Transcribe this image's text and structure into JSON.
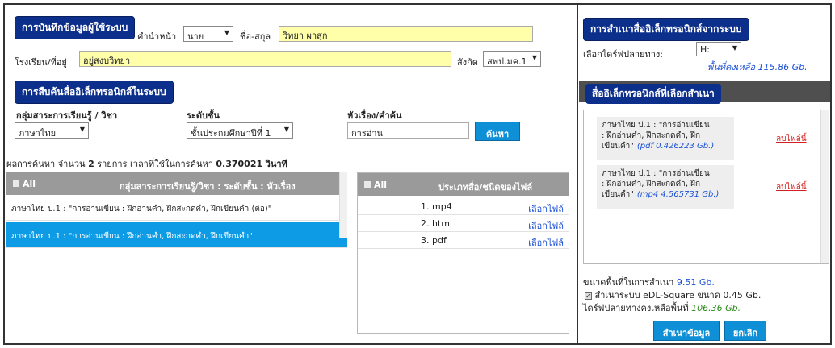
{
  "user_form": {
    "title": "การบันทึกข้อมูลผู้ใช้ระบบ",
    "prefix_label": "คำนำหน้า",
    "prefix_value": "นาย",
    "name_label": "ชื่อ-สกุล",
    "name_value": "วิทยา ผาสุก",
    "school_label": "โรงเรียน/ที่อยู่",
    "school_value": "อยู่สงบวิทยา",
    "affiliation_label": "สังกัด",
    "affiliation_value": "สพป.มค.1"
  },
  "search": {
    "title": "การสืบค้นสื่ออิเล็กทรอนิกส์ในระบบ",
    "subject_label": "กลุ่มสาระการเรียนรู้ / วิชา",
    "subject_value": "ภาษาไทย",
    "level_label": "ระดับชั้น",
    "level_value": "ชั้นประถมศึกษาปีที่ 1",
    "keyword_label": "หัวเรื่อง/คำค้น",
    "keyword_value": "การอ่าน",
    "search_button": "ค้นหา",
    "result_prefix": "ผลการค้นหา จำนวน",
    "result_count": "2",
    "result_mid": "รายการ เวลาที่ใช้ในการค้นหา",
    "result_time": "0.370021",
    "result_unit": "วินาที"
  },
  "results_table": {
    "all_label": "All",
    "header": "กลุ่มสาระการเรียนรู้/วิชา : ระดับชั้น : หัวเรื่อง",
    "rows": [
      {
        "text": "ภาษาไทย ป.1 : \"การอ่านเขียน : ฝึกอ่านคำ, ฝึกสะกดคำ, ฝึกเขียนคำ (ต่อ)\"",
        "selected": false
      },
      {
        "text": "ภาษาไทย ป.1 : \"การอ่านเขียน : ฝึกอ่านคำ, ฝึกสะกดคำ, ฝึกเขียนคำ\"",
        "selected": true
      }
    ]
  },
  "files_table": {
    "all_label": "All",
    "header": "ประเภทสื่อ/ชนิดของไฟล์",
    "select_label": "เลือกไฟล์",
    "rows": [
      "1. mp4",
      "2. htm",
      "3. pdf"
    ]
  },
  "copy_panel": {
    "title": "การสำเนาสื่ออิเล็กทรอนิกส์จากระบบ",
    "drive_label": "เลือกไดร์ฟปลายทาง:",
    "drive_value": "H:",
    "space_left": "พื้นที่คงเหลือ 115.86 Gb.",
    "selected_title": "สื่ออิเล็กทรอนิกส์ที่เลือกสำเนา",
    "items": [
      {
        "line1": "ภาษาไทย ป.1 : \"การอ่านเขียน",
        "line2": ": ฝึกอ่านคำ, ฝึกสะกดคำ, ฝึก",
        "line3": "เขียนคำ\"",
        "file": "(pdf 0.426223 Gb.)",
        "delete": "ลบไฟล์นี้"
      },
      {
        "line1": "ภาษาไทย ป.1 : \"การอ่านเขียน",
        "line2": ": ฝึกอ่านคำ, ฝึกสะกดคำ, ฝึก",
        "line3": "เขียนคำ\"",
        "file": "(mp4 4.565731 Gb.)",
        "delete": "ลบไฟล์นี้"
      }
    ],
    "copy_size_label": "ขนาดพื้นที่ในการสำเนา",
    "copy_size_value": "9.51 Gb.",
    "system_copy_label": "สำเนาระบบ eDL-Square ขนาด 0.45 Gb.",
    "system_copy_checked": true,
    "remaining_label": "ไดร์ฟปลายทางคงเหลือพื้นที่",
    "remaining_value": "106.36 Gb.",
    "copy_button": "สำเนาข้อมูล",
    "cancel_button": "ยกเลิก"
  },
  "colors": {
    "title_bg": "#0d2f8c",
    "accent_button": "#0f8fd6",
    "highlight_input": "#ffffaa",
    "selected_row": "#0e9be6",
    "delete_link": "#d42020"
  }
}
